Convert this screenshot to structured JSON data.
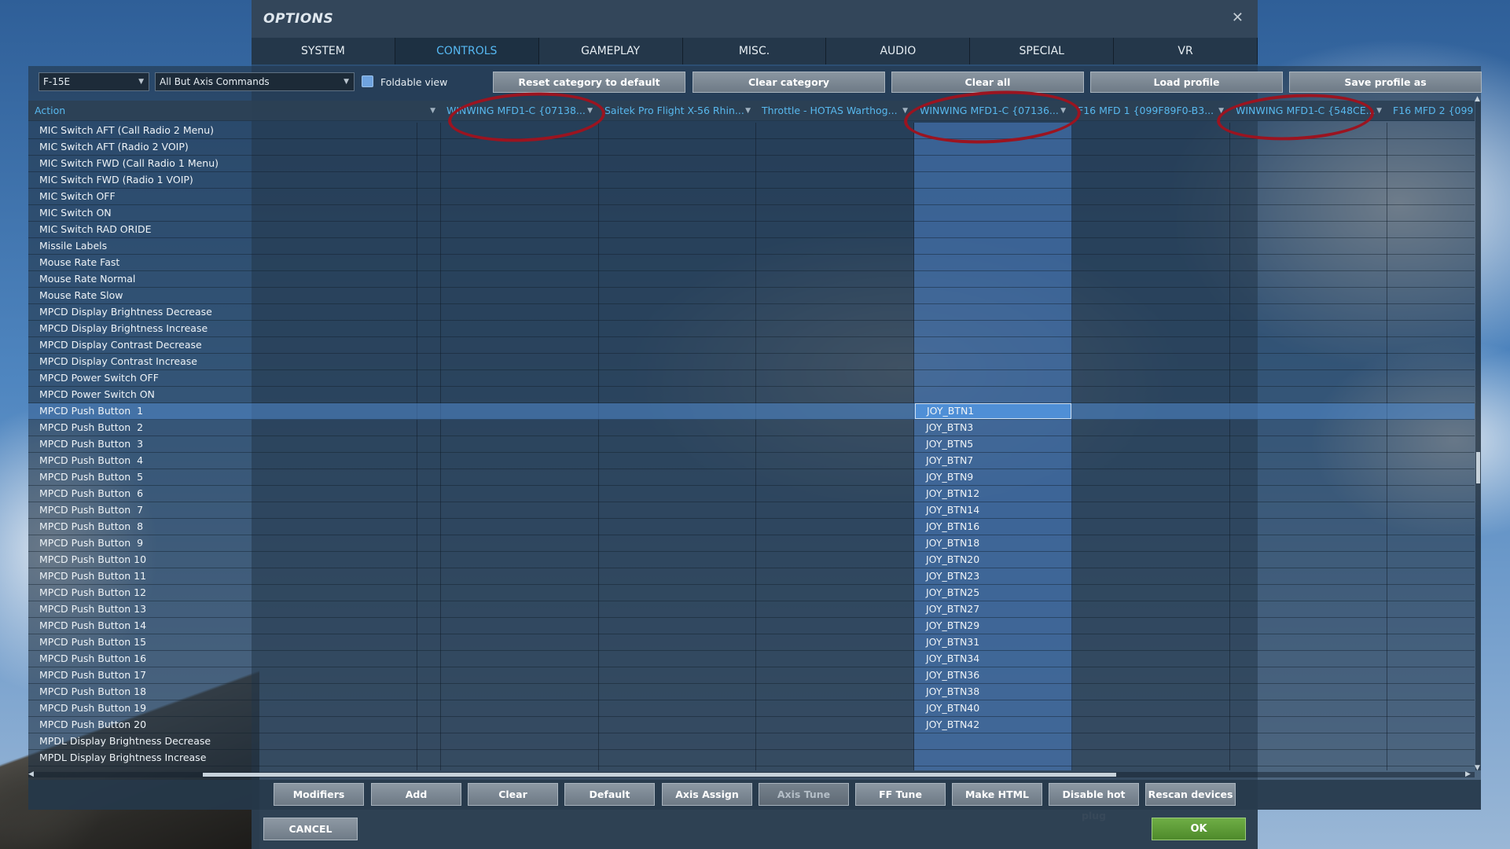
{
  "window": {
    "title": "OPTIONS",
    "close_glyph": "✕"
  },
  "tabs": [
    {
      "label": "SYSTEM"
    },
    {
      "label": "CONTROLS",
      "active": true
    },
    {
      "label": "GAMEPLAY"
    },
    {
      "label": "MISC."
    },
    {
      "label": "AUDIO"
    },
    {
      "label": "SPECIAL"
    },
    {
      "label": "VR"
    }
  ],
  "toolbar": {
    "aircraft_select": "F-15E",
    "category_select": "All But Axis Commands",
    "foldable_view_label": "Foldable view",
    "foldable_view_checked": true,
    "reset_category_label": "Reset category to default",
    "clear_category_label": "Clear category",
    "clear_all_label": "Clear all",
    "load_profile_label": "Load profile",
    "save_profile_as_label": "Save profile as"
  },
  "grid": {
    "action_header": "Action",
    "device_columns": [
      "WINWING MFD1-C {07138...",
      "Saitek Pro Flight X-56 Rhin...",
      "Throttle - HOTAS Warthog...",
      "WINWING MFD1-C {07136...",
      "F16 MFD 1 {099F89F0-B3...",
      "WINWING MFD1-C {548CE...",
      "F16 MFD 2 {099"
    ],
    "highlighted_column_index": 3,
    "rows": [
      {
        "action": "MIC Switch AFT (Call Radio 2 Menu)",
        "binding": ""
      },
      {
        "action": "MIC Switch AFT (Radio 2 VOIP)",
        "binding": ""
      },
      {
        "action": "MIC Switch FWD (Call Radio 1 Menu)",
        "binding": ""
      },
      {
        "action": "MIC Switch FWD (Radio 1 VOIP)",
        "binding": ""
      },
      {
        "action": "MIC Switch OFF",
        "binding": ""
      },
      {
        "action": "MIC Switch ON",
        "binding": ""
      },
      {
        "action": "MIC Switch RAD ORIDE",
        "binding": ""
      },
      {
        "action": "Missile Labels",
        "binding": ""
      },
      {
        "action": "Mouse Rate Fast",
        "binding": ""
      },
      {
        "action": "Mouse Rate Normal",
        "binding": ""
      },
      {
        "action": "Mouse Rate Slow",
        "binding": ""
      },
      {
        "action": "MPCD Display Brightness Decrease",
        "binding": ""
      },
      {
        "action": "MPCD Display Brightness Increase",
        "binding": ""
      },
      {
        "action": "MPCD Display Contrast Decrease",
        "binding": ""
      },
      {
        "action": "MPCD Display Contrast Increase",
        "binding": ""
      },
      {
        "action": "MPCD Power Switch OFF",
        "binding": ""
      },
      {
        "action": "MPCD Power Switch ON",
        "binding": ""
      },
      {
        "action": "MPCD Push Button  1",
        "binding": "JOY_BTN1",
        "selected": true
      },
      {
        "action": "MPCD Push Button  2",
        "binding": "JOY_BTN3"
      },
      {
        "action": "MPCD Push Button  3",
        "binding": "JOY_BTN5"
      },
      {
        "action": "MPCD Push Button  4",
        "binding": "JOY_BTN7"
      },
      {
        "action": "MPCD Push Button  5",
        "binding": "JOY_BTN9"
      },
      {
        "action": "MPCD Push Button  6",
        "binding": "JOY_BTN12"
      },
      {
        "action": "MPCD Push Button  7",
        "binding": "JOY_BTN14"
      },
      {
        "action": "MPCD Push Button  8",
        "binding": "JOY_BTN16"
      },
      {
        "action": "MPCD Push Button  9",
        "binding": "JOY_BTN18"
      },
      {
        "action": "MPCD Push Button 10",
        "binding": "JOY_BTN20"
      },
      {
        "action": "MPCD Push Button 11",
        "binding": "JOY_BTN23"
      },
      {
        "action": "MPCD Push Button 12",
        "binding": "JOY_BTN25"
      },
      {
        "action": "MPCD Push Button 13",
        "binding": "JOY_BTN27"
      },
      {
        "action": "MPCD Push Button 14",
        "binding": "JOY_BTN29"
      },
      {
        "action": "MPCD Push Button 15",
        "binding": "JOY_BTN31"
      },
      {
        "action": "MPCD Push Button 16",
        "binding": "JOY_BTN34"
      },
      {
        "action": "MPCD Push Button 17",
        "binding": "JOY_BTN36"
      },
      {
        "action": "MPCD Push Button 18",
        "binding": "JOY_BTN38"
      },
      {
        "action": "MPCD Push Button 19",
        "binding": "JOY_BTN40"
      },
      {
        "action": "MPCD Push Button 20",
        "binding": "JOY_BTN42"
      },
      {
        "action": "MPDL Display Brightness Decrease",
        "binding": ""
      },
      {
        "action": "MPDL Display Brightness Increase",
        "binding": ""
      }
    ]
  },
  "bottom_buttons": [
    {
      "label": "Modifiers"
    },
    {
      "label": "Add"
    },
    {
      "label": "Clear"
    },
    {
      "label": "Default"
    },
    {
      "label": "Axis Assign"
    },
    {
      "label": "Axis Tune",
      "disabled": true
    },
    {
      "label": "FF Tune"
    },
    {
      "label": "Make HTML"
    },
    {
      "label": "Disable hot plug"
    },
    {
      "label": "Rescan devices"
    }
  ],
  "footer": {
    "cancel_label": "CANCEL",
    "ok_label": "OK"
  },
  "colors": {
    "accent": "#56b8f2",
    "ok_green": "#5a9a35",
    "annotation_red": "#9b1420"
  }
}
